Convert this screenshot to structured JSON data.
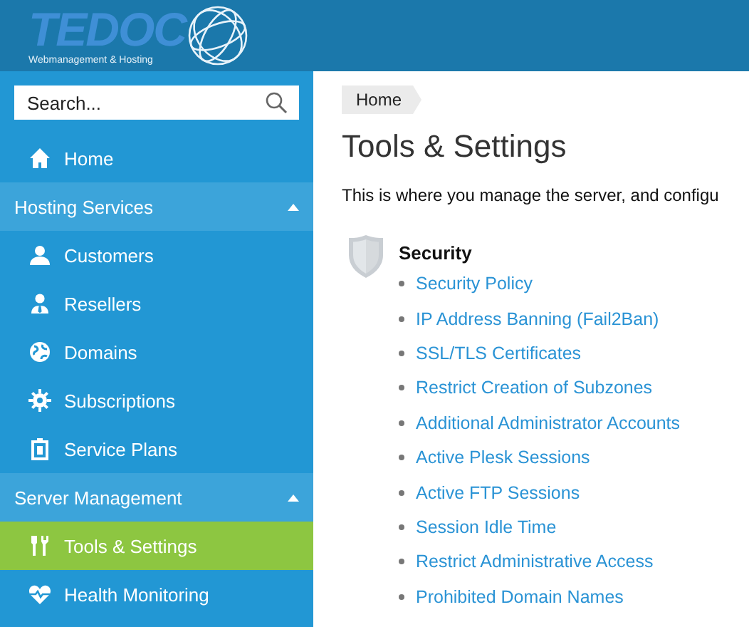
{
  "logo": {
    "name": "TEDOC",
    "tagline": "Webmanagement & Hosting"
  },
  "search": {
    "placeholder": "Search..."
  },
  "sidebar": {
    "items": [
      {
        "kind": "link",
        "label": "Home",
        "selected": false
      },
      {
        "kind": "section",
        "label": "Hosting Services",
        "expanded": true
      },
      {
        "kind": "link",
        "label": "Customers",
        "selected": false
      },
      {
        "kind": "link",
        "label": "Resellers",
        "selected": false
      },
      {
        "kind": "link",
        "label": "Domains",
        "selected": false
      },
      {
        "kind": "link",
        "label": "Subscriptions",
        "selected": false
      },
      {
        "kind": "link",
        "label": "Service Plans",
        "selected": false
      },
      {
        "kind": "section",
        "label": "Server Management",
        "expanded": true
      },
      {
        "kind": "link",
        "label": "Tools & Settings",
        "selected": true
      },
      {
        "kind": "link",
        "label": "Health Monitoring",
        "selected": false
      }
    ]
  },
  "breadcrumb": [
    "Home"
  ],
  "title": "Tools & Settings",
  "description": "This is where you manage the server, and configu",
  "groups": [
    {
      "title": "Security",
      "links": [
        "Security Policy",
        "IP Address Banning (Fail2Ban)",
        "SSL/TLS Certificates",
        "Restrict Creation of Subzones",
        "Additional Administrator Accounts",
        "Active Plesk Sessions",
        "Active FTP Sessions",
        "Session Idle Time",
        "Restrict Administrative Access",
        "Prohibited Domain Names"
      ]
    }
  ]
}
